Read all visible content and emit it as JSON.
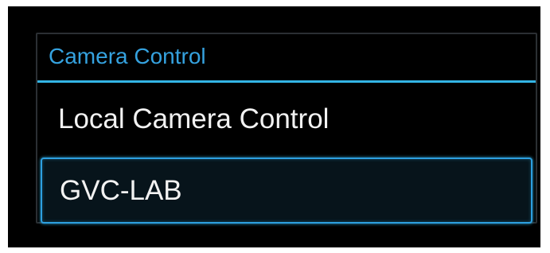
{
  "dialog": {
    "title": "Camera Control",
    "accent_color": "#33b5e5",
    "options": [
      {
        "label": "Local Camera Control",
        "selected": false
      },
      {
        "label": "GVC-LAB",
        "selected": true
      }
    ]
  }
}
